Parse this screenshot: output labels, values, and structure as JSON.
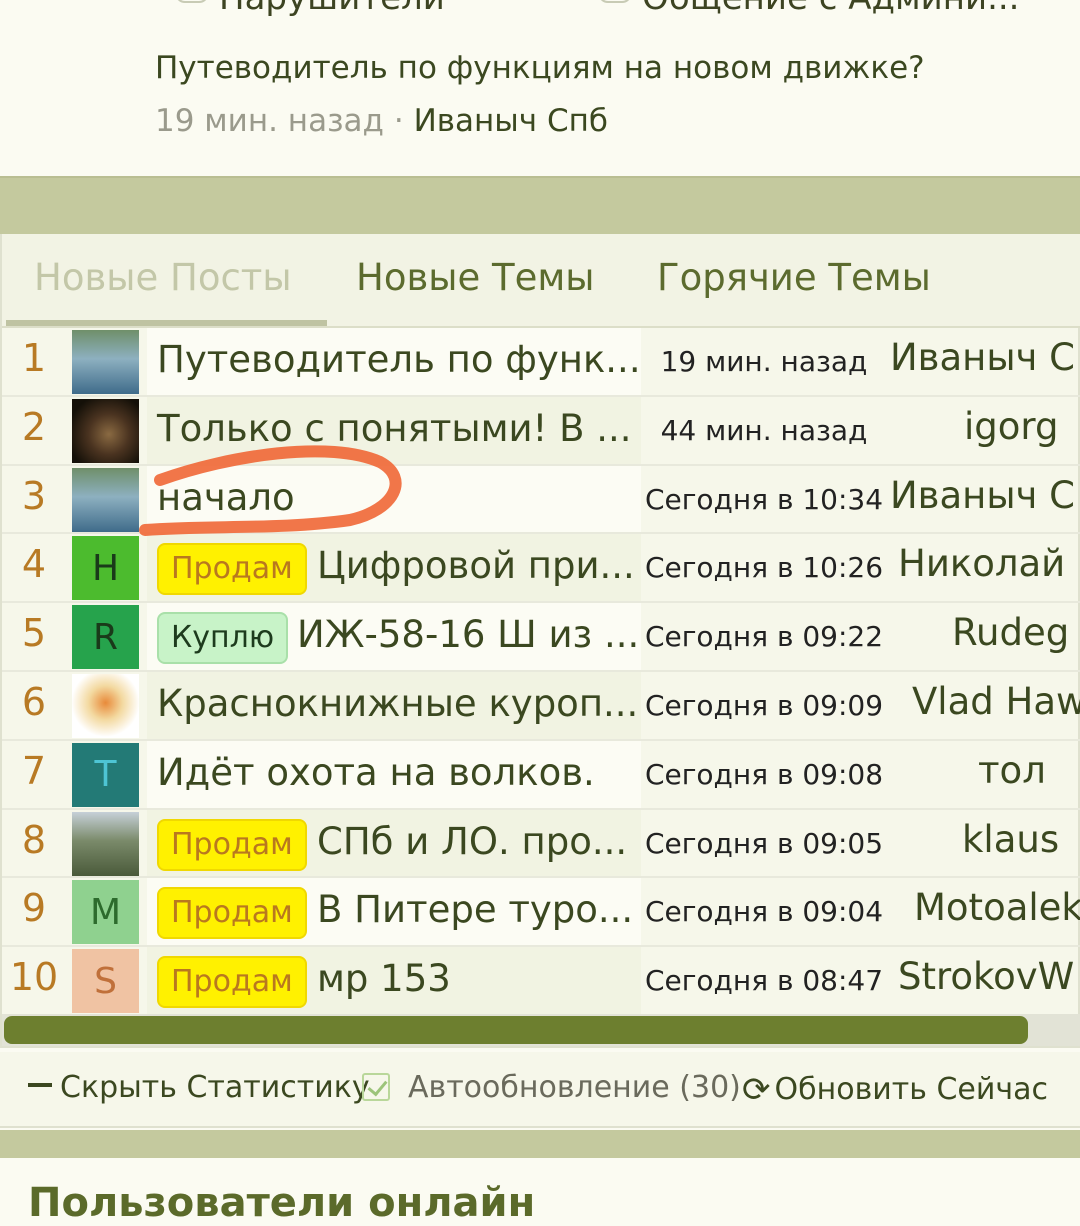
{
  "top_categories": [
    "Нарушители",
    "Общение с Админи..."
  ],
  "last_post": {
    "title": "Путеводитель по функциям на новом движке?",
    "time": "19 мин. назад",
    "separator": "·",
    "author": "Иваныч Спб"
  },
  "tabs": [
    {
      "label": "Новые Посты",
      "active": true
    },
    {
      "label": "Новые Темы",
      "active": false
    },
    {
      "label": "Горячие Темы",
      "active": false
    }
  ],
  "rows": [
    {
      "num": "1",
      "avatar": "",
      "prefix": "",
      "title": "Путеводитель по функ...",
      "time": "19 мин. назад",
      "user": "Иваныч С"
    },
    {
      "num": "2",
      "avatar": "",
      "prefix": "",
      "title": "Только с понятыми! В ...",
      "time": "44 мин. назад",
      "user": "igorg"
    },
    {
      "num": "3",
      "avatar": "",
      "prefix": "",
      "title": "начало",
      "time": "Сегодня в 10:34",
      "user": "Иваныч С"
    },
    {
      "num": "4",
      "avatar": "Н",
      "prefix": "Продам",
      "title": "Цифровой при...",
      "time": "Сегодня в 10:26",
      "user": "Николай ("
    },
    {
      "num": "5",
      "avatar": "R",
      "prefix": "Куплю",
      "title": "ИЖ-58-16 Ш из ...",
      "time": "Сегодня в 09:22",
      "user": "Rudeg"
    },
    {
      "num": "6",
      "avatar": "",
      "prefix": "",
      "title": "Краснокнижные куроп...",
      "time": "Сегодня в 09:09",
      "user": "Vlad Haw"
    },
    {
      "num": "7",
      "avatar": "T",
      "prefix": "",
      "title": "Идёт охота на волков.",
      "time": "Сегодня в 09:08",
      "user": "тол"
    },
    {
      "num": "8",
      "avatar": "",
      "prefix": "Продам",
      "title": "СПб и ЛО. про...",
      "time": "Сегодня в 09:05",
      "user": "klaus"
    },
    {
      "num": "9",
      "avatar": "M",
      "prefix": "Продам",
      "title": "В Питере туро...",
      "time": "Сегодня в 09:04",
      "user": "Motoalek"
    },
    {
      "num": "10",
      "avatar": "S",
      "prefix": "Продам",
      "title": "мр 153",
      "time": "Сегодня в 08:47",
      "user": "StrokovW"
    }
  ],
  "controls": {
    "hide_stats": "Скрыть Статистику",
    "auto_update": "Автообновление (30)",
    "refresh_now": "Обновить Сейчас"
  },
  "online_title": "Пользователи онлайн",
  "colors": {
    "accent": "#5b6a2a",
    "bar": "#c4c99e",
    "scroll_thumb": "#6d7f2f",
    "annotation": "#f06a3a"
  }
}
